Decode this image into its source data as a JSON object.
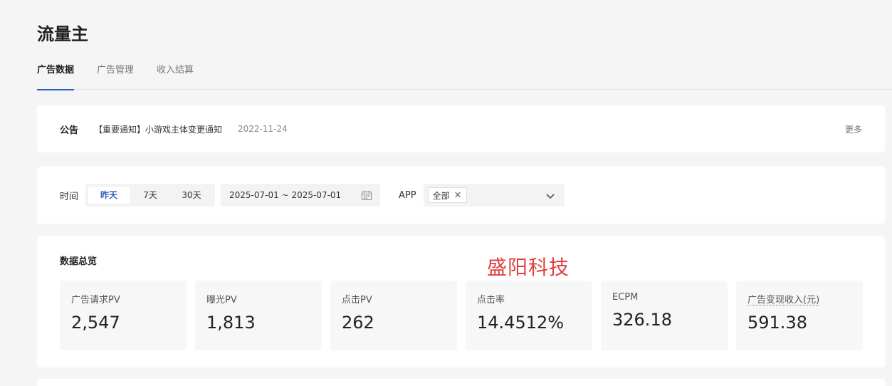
{
  "page": {
    "title": "流量主"
  },
  "tabs": [
    {
      "label": "广告数据",
      "active": true
    },
    {
      "label": "广告管理",
      "active": false
    },
    {
      "label": "收入结算",
      "active": false
    }
  ],
  "notice": {
    "label": "公告",
    "text": "【重要通知】小游戏主体变更通知",
    "date": "2022-11-24",
    "more": "更多"
  },
  "filter": {
    "time_label": "时间",
    "periods": [
      {
        "label": "昨天",
        "active": true
      },
      {
        "label": "7天",
        "active": false
      },
      {
        "label": "30天",
        "active": false
      }
    ],
    "date_range": "2025-07-01 ~ 2025-07-01",
    "app_label": "APP",
    "app_tag": "全部"
  },
  "overview": {
    "title": "数据总览",
    "watermark": "盛阳科技",
    "metrics": [
      {
        "label": "广告请求PV",
        "value": "2,547"
      },
      {
        "label": "曝光PV",
        "value": "1,813"
      },
      {
        "label": "点击PV",
        "value": "262"
      },
      {
        "label": "点击率",
        "value": "14.4512%"
      },
      {
        "label": "ECPM",
        "value": "326.18"
      },
      {
        "label": "广告变现收入(元)",
        "value": "591.38"
      }
    ]
  },
  "colors": {
    "accent": "#2b5fb8",
    "watermark": "#e0403f",
    "background": "#f5f5f5"
  },
  "icons": {
    "calendar": "calendar-icon",
    "close": "close-icon",
    "chevron": "chevron-down-icon"
  }
}
